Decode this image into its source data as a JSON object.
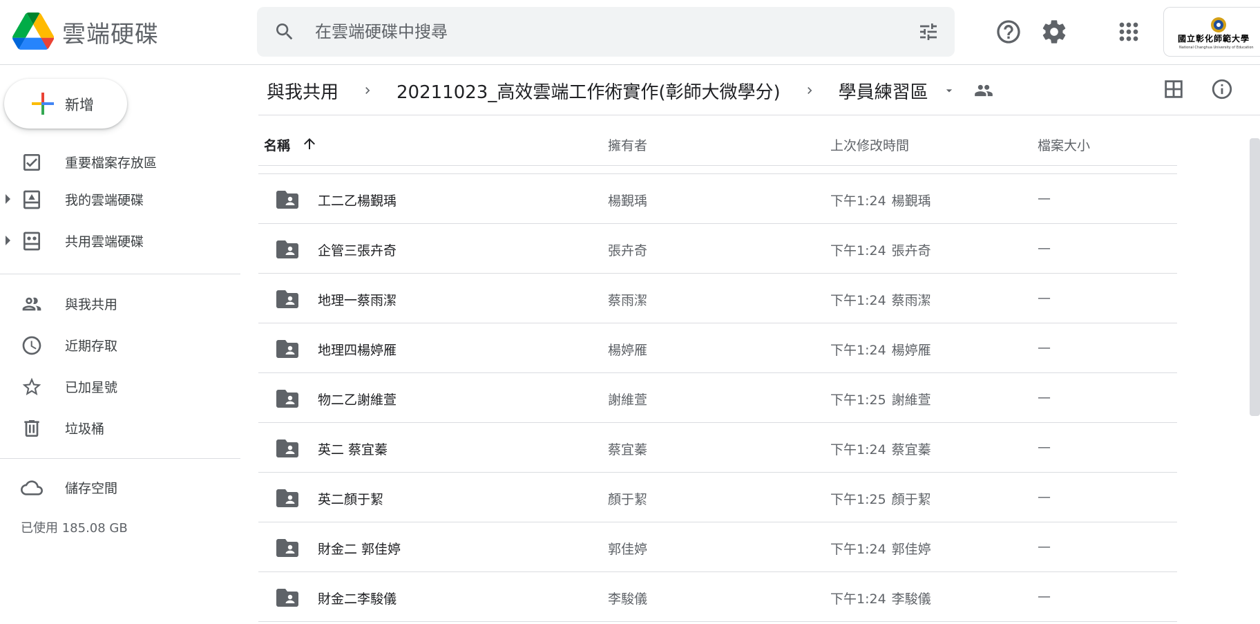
{
  "app": {
    "title": "雲端硬碟"
  },
  "search": {
    "placeholder": "在雲端硬碟中搜尋",
    "value": ""
  },
  "account": {
    "name": "國立彰化師範大學",
    "name_en": "National Changhua University of Education"
  },
  "icons": {
    "logo": "google-drive-logo-icon",
    "search": "search-icon",
    "filter": "tune-icon",
    "help": "help-icon",
    "settings": "gear-icon",
    "apps": "apps-grid-icon",
    "grid_view": "grid-view-icon",
    "info": "info-icon"
  },
  "sidebar": {
    "new_label": "新增",
    "items": [
      {
        "label": "重要檔案存放區",
        "icon": "priority-check-icon",
        "expandable": false
      },
      {
        "label": "我的雲端硬碟",
        "icon": "my-drive-icon",
        "expandable": true
      },
      {
        "label": "共用雲端硬碟",
        "icon": "shared-drives-icon",
        "expandable": true
      },
      {
        "label": "與我共用",
        "icon": "shared-with-me-icon",
        "expandable": false
      },
      {
        "label": "近期存取",
        "icon": "clock-icon",
        "expandable": false
      },
      {
        "label": "已加星號",
        "icon": "star-icon",
        "expandable": false
      },
      {
        "label": "垃圾桶",
        "icon": "trash-icon",
        "expandable": false
      },
      {
        "label": "儲存空間",
        "icon": "cloud-icon",
        "expandable": false
      }
    ],
    "storage_used": "已使用 185.08 GB"
  },
  "breadcrumb": {
    "items": [
      "與我共用",
      "20211023_高效雲端工作術實作(彰師大微學分)",
      "學員練習區"
    ]
  },
  "table": {
    "columns": {
      "name": "名稱",
      "owner": "擁有者",
      "modified": "上次修改時間",
      "size": "檔案大小"
    },
    "rows": [
      {
        "name": "工二乙楊覲瑀",
        "owner": "楊覲瑀",
        "time": "下午1:24",
        "by": "楊覲瑀",
        "size": "—"
      },
      {
        "name": "企管三張卉奇",
        "owner": "張卉奇",
        "time": "下午1:24",
        "by": "張卉奇",
        "size": "—"
      },
      {
        "name": "地理一蔡雨潔",
        "owner": "蔡雨潔",
        "time": "下午1:24",
        "by": "蔡雨潔",
        "size": "—"
      },
      {
        "name": "地理四楊婷雁",
        "owner": "楊婷雁",
        "time": "下午1:24",
        "by": "楊婷雁",
        "size": "—"
      },
      {
        "name": "物二乙謝維萱",
        "owner": "謝維萱",
        "time": "下午1:25",
        "by": "謝維萱",
        "size": "—"
      },
      {
        "name": "英二 蔡宜蓁",
        "owner": "蔡宜蓁",
        "time": "下午1:24",
        "by": "蔡宜蓁",
        "size": "—"
      },
      {
        "name": "英二顏于絜",
        "owner": "顏于絜",
        "time": "下午1:25",
        "by": "顏于絜",
        "size": "—"
      },
      {
        "name": "財金二 郭佳婷",
        "owner": "郭佳婷",
        "time": "下午1:24",
        "by": "郭佳婷",
        "size": "—"
      },
      {
        "name": "財金二李駿儀",
        "owner": "李駿儀",
        "time": "下午1:24",
        "by": "李駿儀",
        "size": "—"
      }
    ]
  }
}
